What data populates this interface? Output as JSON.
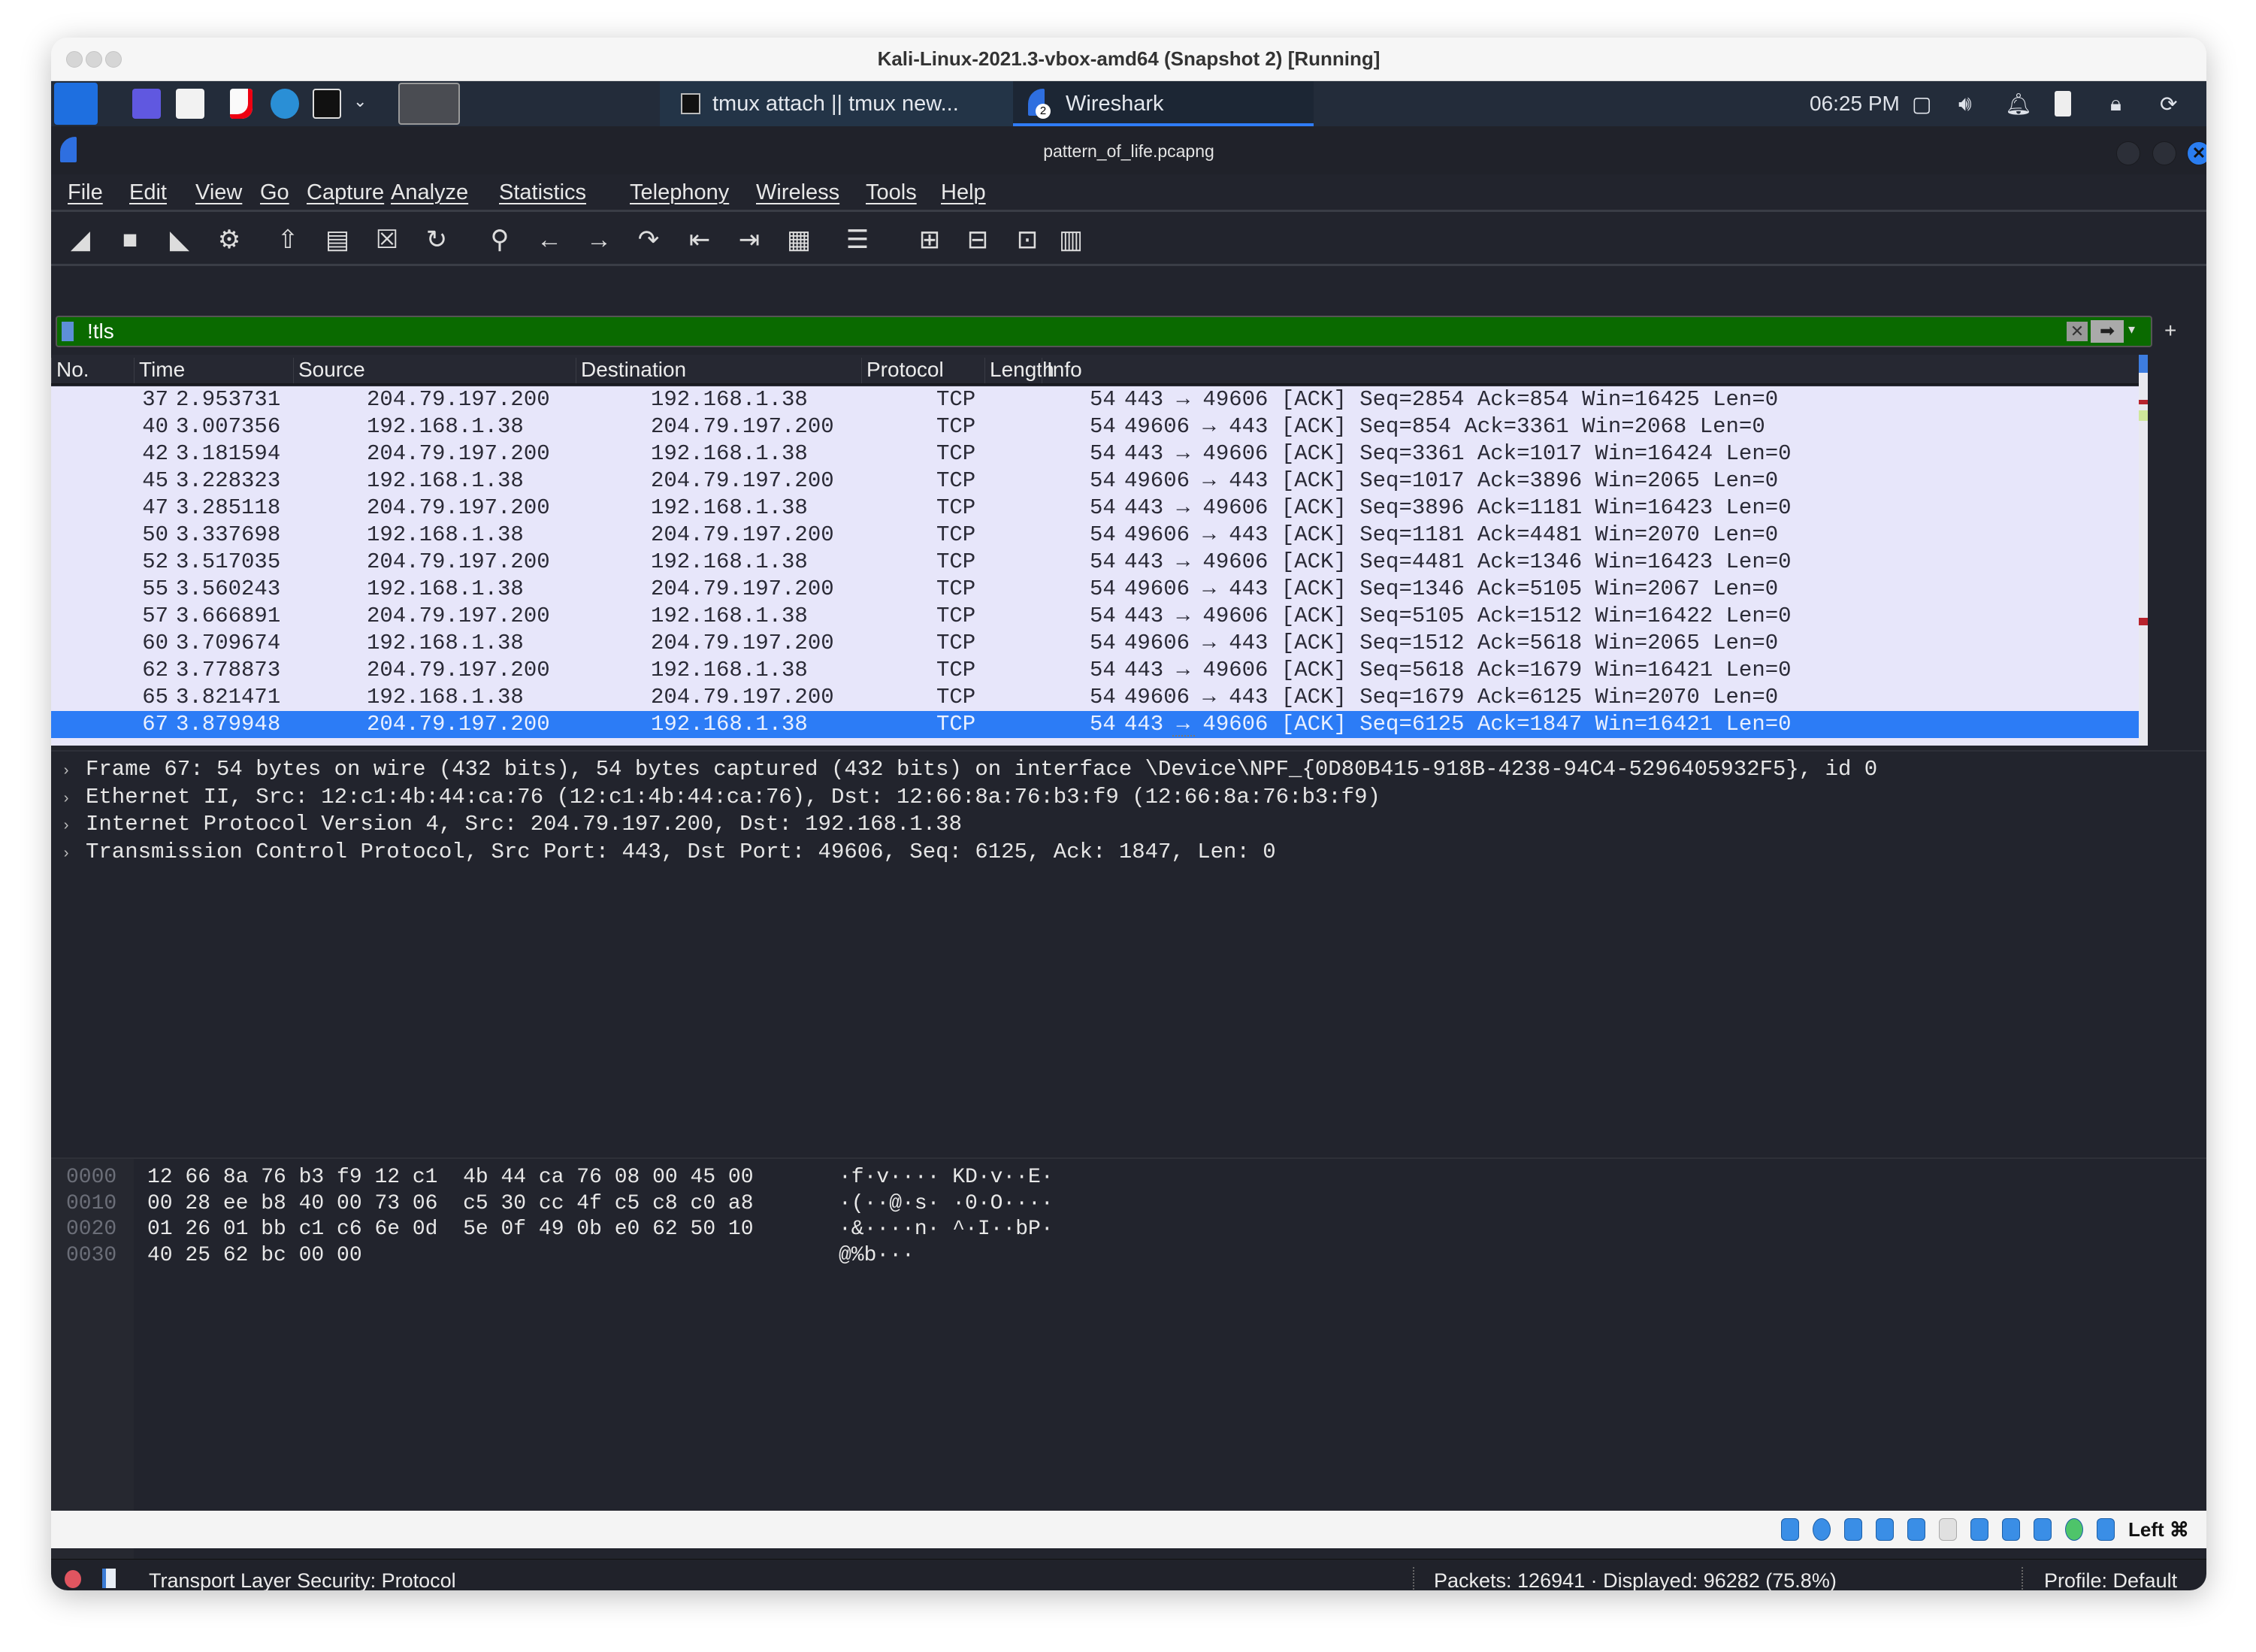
{
  "vm_window": {
    "title": "Kali-Linux-2021.3-vbox-amd64 (Snapshot 2) [Running]"
  },
  "taskbar": {
    "tasks": [
      {
        "label": "tmux attach || tmux new..."
      },
      {
        "label": "Wireshark",
        "badge": "2",
        "active": true
      }
    ],
    "clock": "06:25 PM"
  },
  "app": {
    "title": "pattern_of_life.pcapng",
    "menu": [
      "File",
      "Edit",
      "View",
      "Go",
      "Capture",
      "Analyze",
      "Statistics",
      "Telephony",
      "Wireless",
      "Tools",
      "Help"
    ],
    "toolbar_icons": [
      "shark-fin-start-icon",
      "stop-icon",
      "restart-icon",
      "options-gear-icon",
      "open-icon",
      "save-icon",
      "close-file-icon",
      "reload-icon",
      "search-icon",
      "back-arrow-icon",
      "forward-arrow-icon",
      "go-to-packet-icon",
      "first-packet-icon",
      "last-packet-icon",
      "autoscroll-icon",
      "colorize-icon",
      "zoom-in-icon",
      "zoom-out-icon",
      "normal-size-icon",
      "resize-columns-icon"
    ],
    "filter": {
      "value": "!tls",
      "add_label": "+"
    },
    "colors": {
      "filter_valid": "#0a6a00",
      "row_tcp": "#e7e6fa",
      "row_selected": "#2c7cf6",
      "background": "#22242d"
    }
  },
  "packet_list": {
    "columns": [
      "No.",
      "Time",
      "Source",
      "Destination",
      "Protocol",
      "Length",
      "Info"
    ],
    "rows": [
      {
        "no": "37",
        "time": "2.953731",
        "src": "204.79.197.200",
        "dst": "192.168.1.38",
        "proto": "TCP",
        "len": "54",
        "info": "443 → 49606 [ACK] Seq=2854 Ack=854 Win=16425 Len=0"
      },
      {
        "no": "40",
        "time": "3.007356",
        "src": "192.168.1.38",
        "dst": "204.79.197.200",
        "proto": "TCP",
        "len": "54",
        "info": "49606 → 443 [ACK] Seq=854 Ack=3361 Win=2068 Len=0"
      },
      {
        "no": "42",
        "time": "3.181594",
        "src": "204.79.197.200",
        "dst": "192.168.1.38",
        "proto": "TCP",
        "len": "54",
        "info": "443 → 49606 [ACK] Seq=3361 Ack=1017 Win=16424 Len=0"
      },
      {
        "no": "45",
        "time": "3.228323",
        "src": "192.168.1.38",
        "dst": "204.79.197.200",
        "proto": "TCP",
        "len": "54",
        "info": "49606 → 443 [ACK] Seq=1017 Ack=3896 Win=2065 Len=0"
      },
      {
        "no": "47",
        "time": "3.285118",
        "src": "204.79.197.200",
        "dst": "192.168.1.38",
        "proto": "TCP",
        "len": "54",
        "info": "443 → 49606 [ACK] Seq=3896 Ack=1181 Win=16423 Len=0"
      },
      {
        "no": "50",
        "time": "3.337698",
        "src": "192.168.1.38",
        "dst": "204.79.197.200",
        "proto": "TCP",
        "len": "54",
        "info": "49606 → 443 [ACK] Seq=1181 Ack=4481 Win=2070 Len=0"
      },
      {
        "no": "52",
        "time": "3.517035",
        "src": "204.79.197.200",
        "dst": "192.168.1.38",
        "proto": "TCP",
        "len": "54",
        "info": "443 → 49606 [ACK] Seq=4481 Ack=1346 Win=16423 Len=0"
      },
      {
        "no": "55",
        "time": "3.560243",
        "src": "192.168.1.38",
        "dst": "204.79.197.200",
        "proto": "TCP",
        "len": "54",
        "info": "49606 → 443 [ACK] Seq=1346 Ack=5105 Win=2067 Len=0"
      },
      {
        "no": "57",
        "time": "3.666891",
        "src": "204.79.197.200",
        "dst": "192.168.1.38",
        "proto": "TCP",
        "len": "54",
        "info": "443 → 49606 [ACK] Seq=5105 Ack=1512 Win=16422 Len=0"
      },
      {
        "no": "60",
        "time": "3.709674",
        "src": "192.168.1.38",
        "dst": "204.79.197.200",
        "proto": "TCP",
        "len": "54",
        "info": "49606 → 443 [ACK] Seq=1512 Ack=5618 Win=2065 Len=0"
      },
      {
        "no": "62",
        "time": "3.778873",
        "src": "204.79.197.200",
        "dst": "192.168.1.38",
        "proto": "TCP",
        "len": "54",
        "info": "443 → 49606 [ACK] Seq=5618 Ack=1679 Win=16421 Len=0"
      },
      {
        "no": "65",
        "time": "3.821471",
        "src": "192.168.1.38",
        "dst": "204.79.197.200",
        "proto": "TCP",
        "len": "54",
        "info": "49606 → 443 [ACK] Seq=1679 Ack=6125 Win=2070 Len=0"
      },
      {
        "no": "67",
        "time": "3.879948",
        "src": "204.79.197.200",
        "dst": "192.168.1.38",
        "proto": "TCP",
        "len": "54",
        "info": "443 → 49606 [ACK] Seq=6125 Ack=1847 Win=16421 Len=0",
        "selected": true
      }
    ]
  },
  "packet_details": [
    "Frame 67: 54 bytes on wire (432 bits), 54 bytes captured (432 bits) on interface \\Device\\NPF_{0D80B415-918B-4238-94C4-5296405932F5}, id 0",
    "Ethernet II, Src: 12:c1:4b:44:ca:76 (12:c1:4b:44:ca:76), Dst: 12:66:8a:76:b3:f9 (12:66:8a:76:b3:f9)",
    "Internet Protocol Version 4, Src: 204.79.197.200, Dst: 192.168.1.38",
    "Transmission Control Protocol, Src Port: 443, Dst Port: 49606, Seq: 6125, Ack: 1847, Len: 0"
  ],
  "hex_dump": [
    {
      "offset": "0000",
      "bytes": "12 66 8a 76 b3 f9 12 c1  4b 44 ca 76 08 00 45 00",
      "ascii": "·f·v···· KD·v··E·"
    },
    {
      "offset": "0010",
      "bytes": "00 28 ee b8 40 00 73 06  c5 30 cc 4f c5 c8 c0 a8",
      "ascii": "·(··@·s· ·0·O····"
    },
    {
      "offset": "0020",
      "bytes": "01 26 01 bb c1 c6 6e 0d  5e 0f 49 0b e0 62 50 10",
      "ascii": "·&····n· ^·I··bP·"
    },
    {
      "offset": "0030",
      "bytes": "40 25 62 bc 00 00",
      "ascii": "@%b···"
    }
  ],
  "status_bar": {
    "expert_info": "Transport Layer Security: Protocol",
    "packets": "Packets: 126941 · Displayed: 96282 (75.8%)",
    "profile": "Profile: Default"
  },
  "vbox_bar": {
    "host_key": "Left ⌘"
  }
}
